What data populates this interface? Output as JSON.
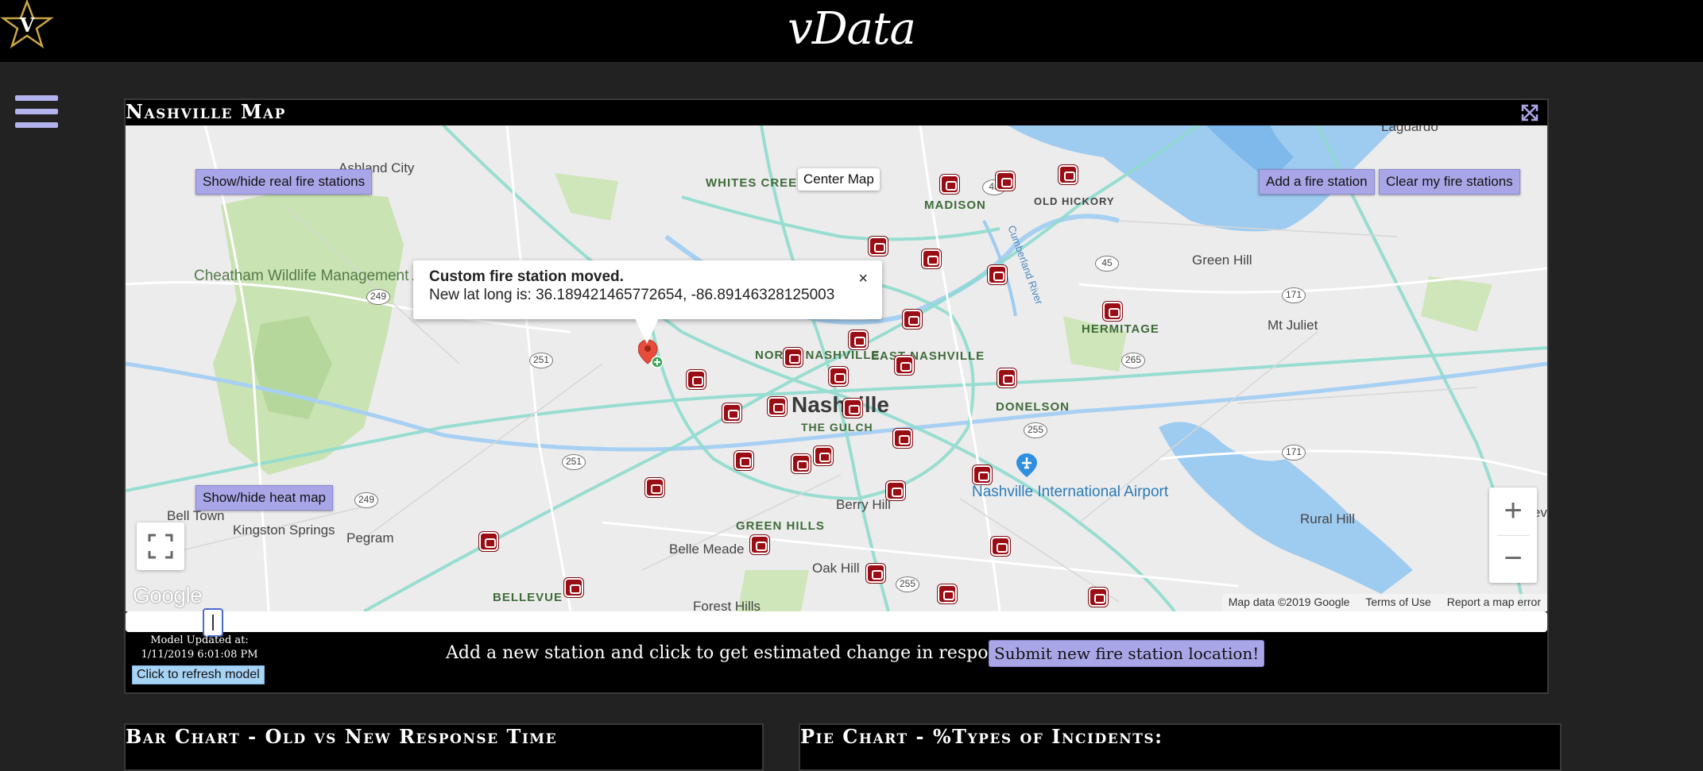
{
  "app": {
    "title": "vData",
    "logo_letter": "V"
  },
  "menu_icon": "hamburger-menu-icon",
  "map_panel": {
    "title": "Nashville Map",
    "expand_icon": "expand-arrows-icon",
    "buttons": {
      "real_stations": "Show/hide real fire stations",
      "heat_map": "Show/hide heat map",
      "center_map": "Center Map",
      "add_station": "Add a fire station",
      "clear_stations": "Clear my fire stations"
    },
    "info_window": {
      "title": "Custom fire station moved.",
      "message": "New lat long is: 36.189421465772654, -86.89146328125003",
      "close": "×"
    },
    "labels": {
      "ashland_city": "Ashland City",
      "whites_creek": "WHITES CREEK",
      "madison": "MADISON",
      "old_hickory": "OLD HICKORY",
      "lagurdo": "Laguardo",
      "green_hill": "Green Hill",
      "mt_juliet": "Mt Juliet",
      "hermitage": "HERMITAGE",
      "cheatham": "Cheatham Wildlife Management Area",
      "north_nashville": "NORTH NASHVILLE",
      "east_nashville": "EAST NASHVILLE",
      "nashville": "Nashville",
      "the_gulch": "THE GULCH",
      "donelson": "DONELSON",
      "airport": "Nashville International Airport",
      "berry_hill": "Berry Hill",
      "green_hills": "GREEN HILLS",
      "belle_meade": "Belle Meade",
      "oak_hill": "Oak Hill",
      "forest_hills": "Forest Hills",
      "bellevue": "BELLEVUE",
      "bell_town": "Bell Town",
      "kingston_springs": "Kingston Springs",
      "pegram": "Pegram",
      "rural_hill": "Rural Hill",
      "gladeville": "Gladevill",
      "cumberland_river": "Cumberland River"
    },
    "shields": [
      "249",
      "251",
      "251",
      "249",
      "45",
      "45",
      "171",
      "265",
      "255",
      "171",
      "255"
    ],
    "zoom_in": "+",
    "zoom_out": "−",
    "google": "Google",
    "attribution": {
      "data": "Map data ©2019 Google",
      "terms": "Terms of Use",
      "report": "Report a map error"
    },
    "model_updated_label": "Model Updated at:",
    "model_updated_time": "1/11/2019 6:01:08 PM",
    "refresh_button": "Click to refresh model",
    "add_station_text": "Add a new station and click to get estimated change in response time:",
    "submit_button": "Submit new fire station location!",
    "stations_count": 35
  },
  "bar_panel": {
    "title": "Bar Chart - Old vs New Response Time"
  },
  "pie_panel": {
    "title": "Pie Chart - %Types of Incidents:"
  },
  "colors": {
    "button": "#a9a6e8",
    "station": "#9b0d14",
    "panel_bg": "#000000",
    "page_bg": "#222222",
    "refresh_button": "#a7d3f5"
  }
}
